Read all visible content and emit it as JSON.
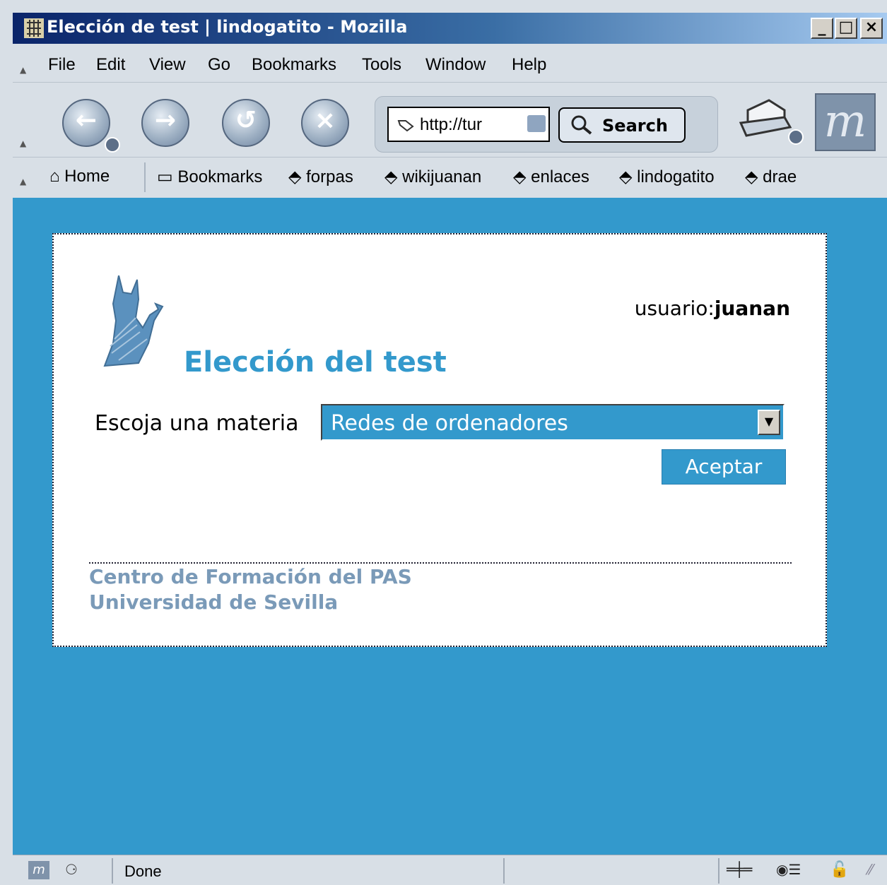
{
  "window": {
    "title": "Elección de test | lindogatito - Mozilla",
    "minimize_glyph": "_",
    "maximize_glyph": "□",
    "close_glyph": "×"
  },
  "menu": {
    "items": [
      {
        "label": "File"
      },
      {
        "label": "Edit"
      },
      {
        "label": "View"
      },
      {
        "label": "Go"
      },
      {
        "label": "Bookmarks"
      },
      {
        "label": "Tools"
      },
      {
        "label": "Window"
      },
      {
        "label": "Help"
      }
    ]
  },
  "navbar": {
    "back_icon": "back-arrow-icon",
    "forward_icon": "forward-arrow-icon",
    "reload_icon": "reload-icon",
    "stop_icon": "stop-icon",
    "url": "http://tur",
    "search_label": "Search"
  },
  "personal_toolbar": {
    "home_label": "Home",
    "bookmarks_label": "Bookmarks",
    "links": [
      {
        "label": "forpas"
      },
      {
        "label": "wikijuanan"
      },
      {
        "label": "enlaces"
      },
      {
        "label": "lindogatito"
      },
      {
        "label": "drae"
      }
    ]
  },
  "page": {
    "user_label": "usuario:",
    "user_name": "juanan",
    "heading": "Elección del test",
    "subject_label": "Escoja una materia",
    "subject_selected": "Redes de ordenadores",
    "accept_label": "Aceptar",
    "footer_line1": "Centro de Formación del PAS",
    "footer_line2": "Universidad de Sevilla",
    "content_bg": "#3399cc"
  },
  "status": {
    "text": "Done"
  }
}
